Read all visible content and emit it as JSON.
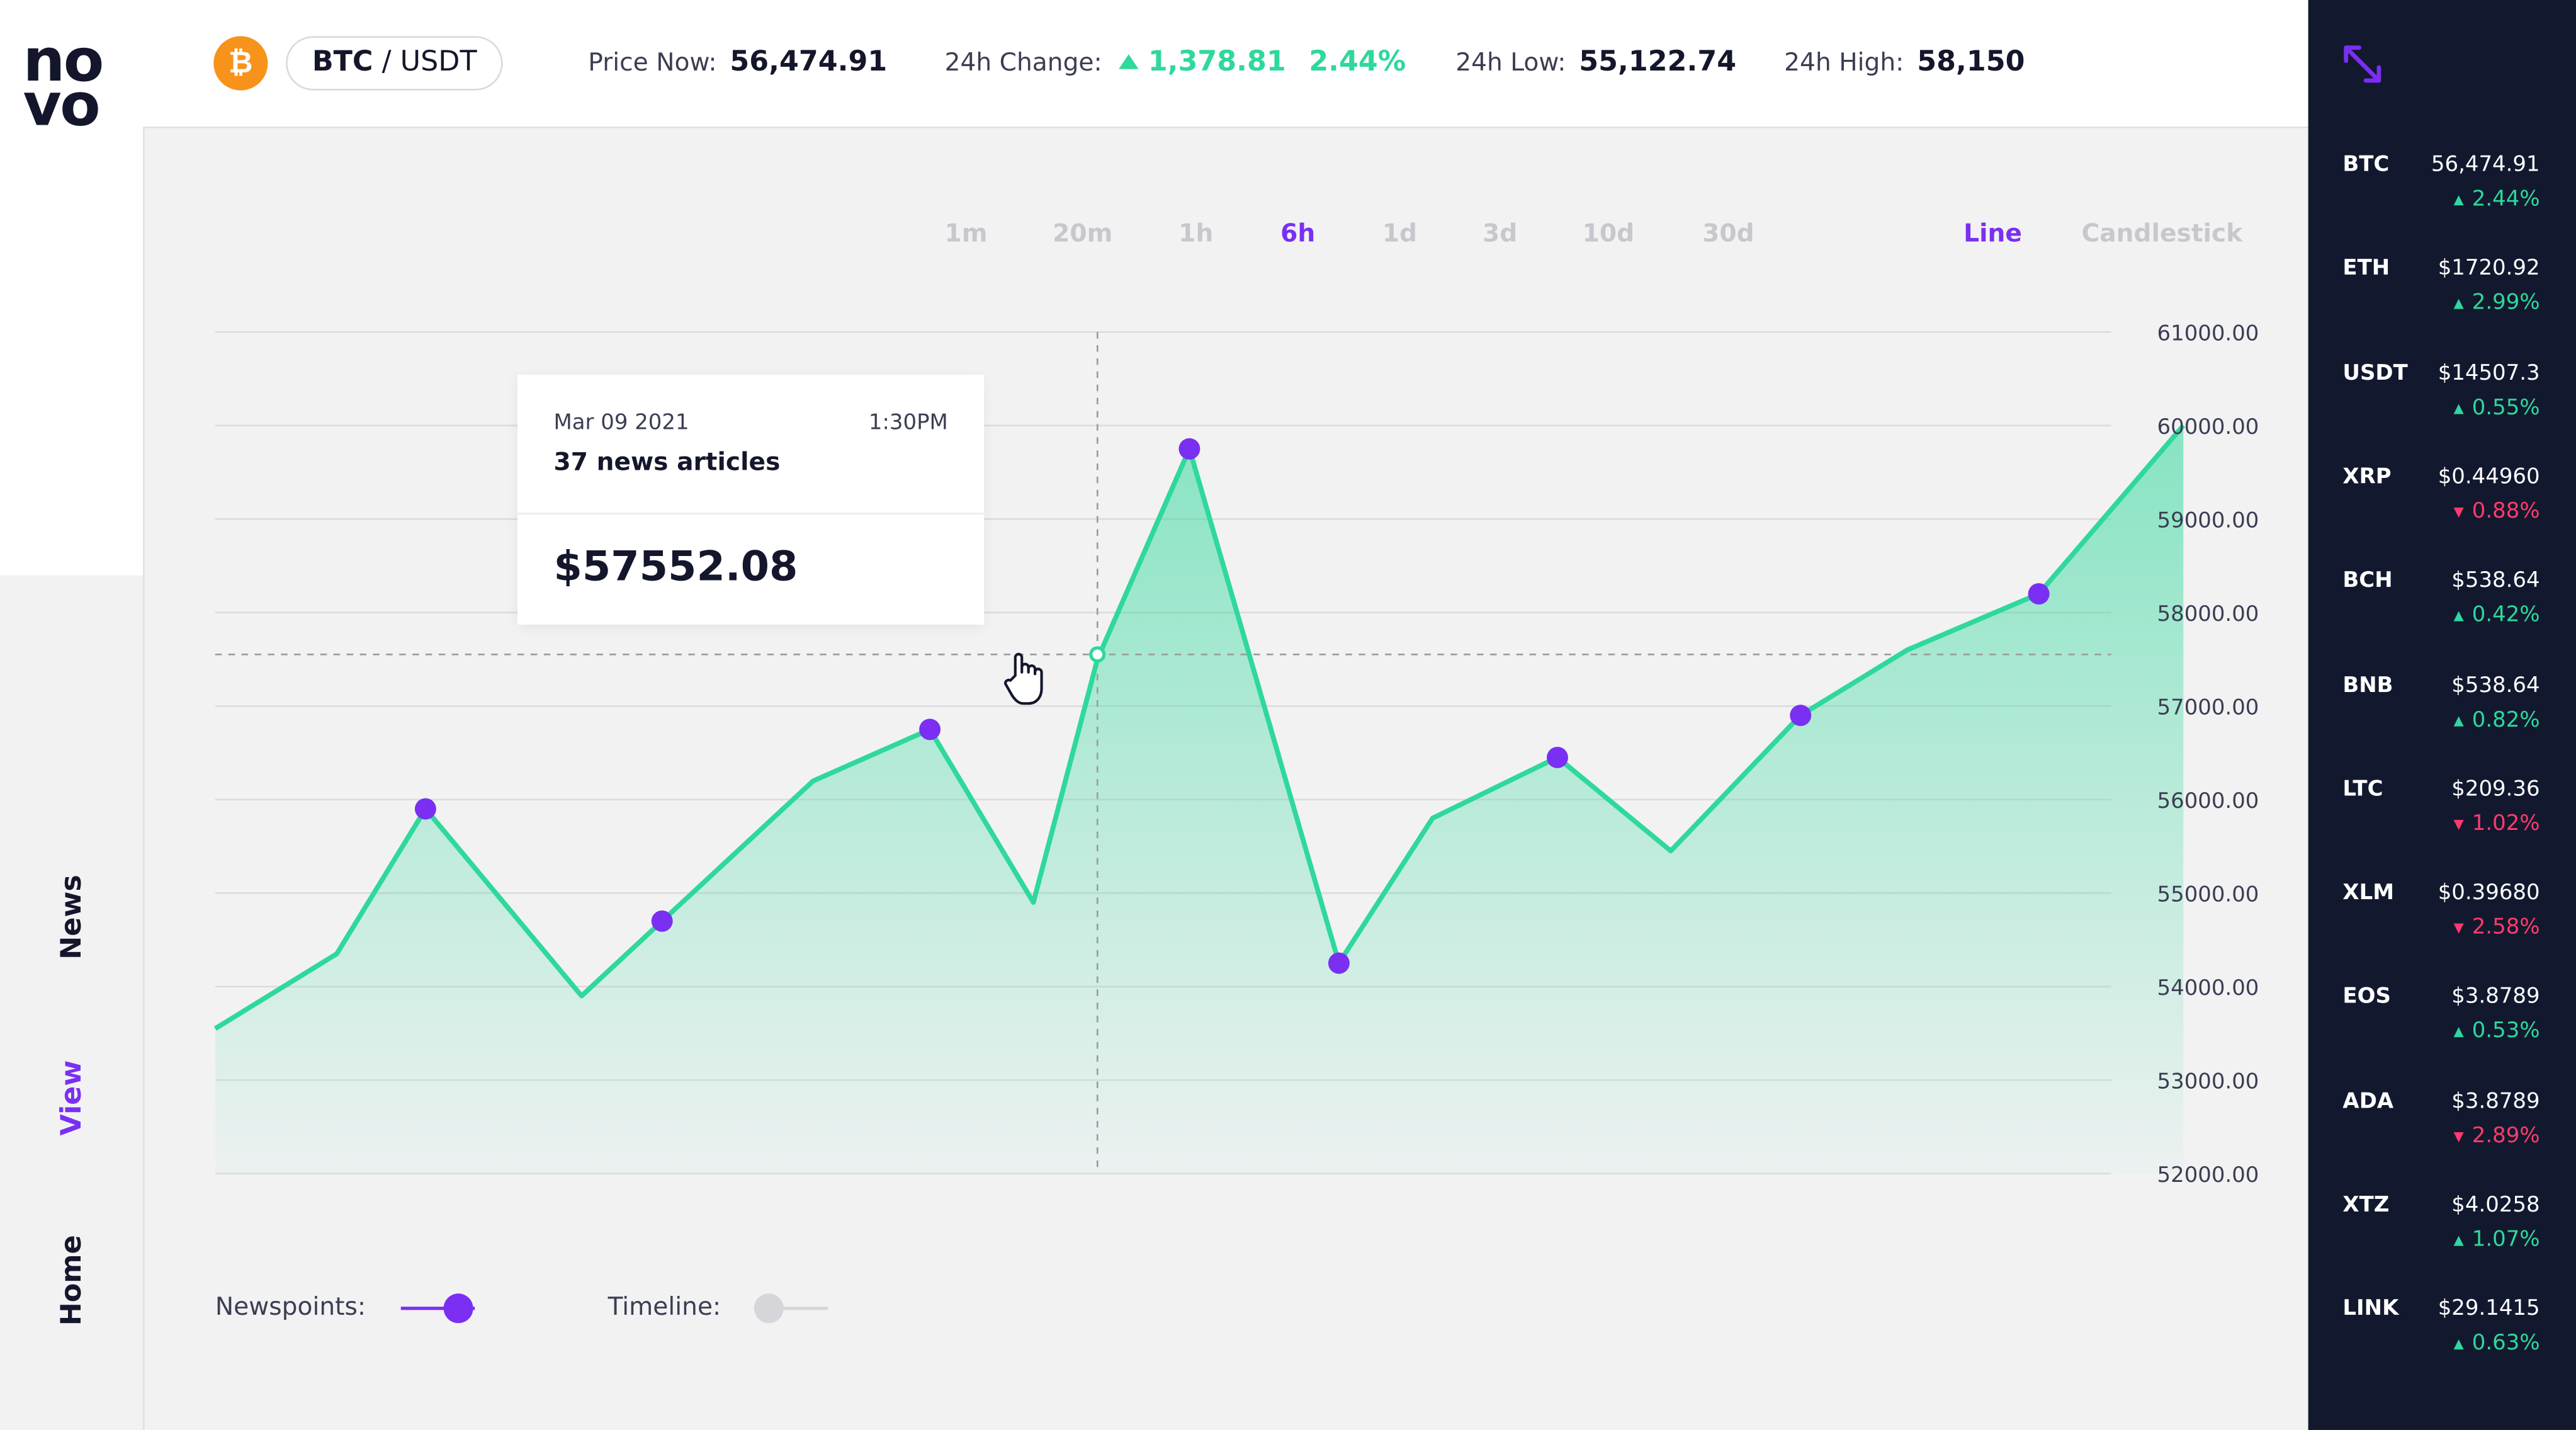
{
  "brand": {
    "logo_top": "no",
    "logo_bottom": "vo"
  },
  "nav": {
    "items": [
      {
        "label": "News",
        "active": false
      },
      {
        "label": "View",
        "active": true
      },
      {
        "label": "Home",
        "active": false
      }
    ]
  },
  "header": {
    "coin_icon": "bitcoin-icon",
    "coin_glyph": "₿",
    "pair_base": "BTC",
    "pair_sep": "/",
    "pair_quote": "USDT",
    "price_label": "Price Now:",
    "price_value": "56,474.91",
    "change_label": "24h Change:",
    "change_value": "1,378.81",
    "change_pct": "2.44%",
    "low_label": "24h Low:",
    "low_value": "55,122.74",
    "high_label": "24h High:",
    "high_value": "58,150"
  },
  "timeframes": [
    {
      "label": "1m",
      "active": false
    },
    {
      "label": "20m",
      "active": false
    },
    {
      "label": "1h",
      "active": false
    },
    {
      "label": "6h",
      "active": true
    },
    {
      "label": "1d",
      "active": false
    },
    {
      "label": "3d",
      "active": false
    },
    {
      "label": "10d",
      "active": false
    },
    {
      "label": "30d",
      "active": false
    }
  ],
  "chart_types": [
    {
      "label": "Line",
      "active": true
    },
    {
      "label": "Candlestick",
      "active": false
    }
  ],
  "tooltip": {
    "date": "Mar 09 2021",
    "time": "1:30PM",
    "articles": "37 news articles",
    "price": "$57552.08"
  },
  "toggles": {
    "newspoints_label": "Newspoints:",
    "newspoints_on": true,
    "timeline_label": "Timeline:",
    "timeline_on": false
  },
  "colors": {
    "accent": "#7a2ff2",
    "line": "#2fd89b",
    "up": "#2fd89b",
    "down": "#ff3b6b",
    "ticker_bg": "#12192f",
    "bitcoin": "#f7931a"
  },
  "chart_data": {
    "type": "area",
    "y_ticks": [
      "61000.00",
      "60000.00",
      "59000.00",
      "58000.00",
      "57000.00",
      "56000.00",
      "55000.00",
      "54000.00",
      "53000.00",
      "52000.00"
    ],
    "ylim": [
      52000,
      61000
    ],
    "grid": true,
    "x": [
      0,
      1,
      2,
      3,
      4,
      5,
      6,
      7,
      8,
      9,
      10,
      11,
      12,
      13,
      14,
      15,
      16,
      17,
      18,
      19
    ],
    "values": [
      53550,
      54350,
      55900,
      53900,
      54700,
      56200,
      56750,
      54900,
      57500,
      59750,
      54250,
      55800,
      56450,
      55450,
      56900,
      57600,
      58200,
      60000
    ],
    "news_points": [
      2,
      4,
      6,
      9,
      10,
      12,
      14,
      16
    ],
    "hover_index": 8,
    "hover_value": 57552.08
  },
  "ticker": {
    "expand_icon": "expand-arrows-icon",
    "items": [
      {
        "symbol": "BTC",
        "price": "56,474.91",
        "change": "2.44%",
        "dir": "up"
      },
      {
        "symbol": "ETH",
        "price": "$1720.92",
        "change": "2.99%",
        "dir": "up"
      },
      {
        "symbol": "USDT",
        "price": "$14507.3",
        "change": "0.55%",
        "dir": "up"
      },
      {
        "symbol": "XRP",
        "price": "$0.44960",
        "change": "0.88%",
        "dir": "down"
      },
      {
        "symbol": "BCH",
        "price": "$538.64",
        "change": "0.42%",
        "dir": "up"
      },
      {
        "symbol": "BNB",
        "price": "$538.64",
        "change": "0.82%",
        "dir": "up"
      },
      {
        "symbol": "LTC",
        "price": "$209.36",
        "change": "1.02%",
        "dir": "down"
      },
      {
        "symbol": "XLM",
        "price": "$0.39680",
        "change": "2.58%",
        "dir": "down"
      },
      {
        "symbol": "EOS",
        "price": "$3.8789",
        "change": "0.53%",
        "dir": "up"
      },
      {
        "symbol": "ADA",
        "price": "$3.8789",
        "change": "2.89%",
        "dir": "down"
      },
      {
        "symbol": "XTZ",
        "price": "$4.0258",
        "change": "1.07%",
        "dir": "up"
      },
      {
        "symbol": "LINK",
        "price": "$29.1415",
        "change": "0.63%",
        "dir": "up"
      }
    ]
  }
}
